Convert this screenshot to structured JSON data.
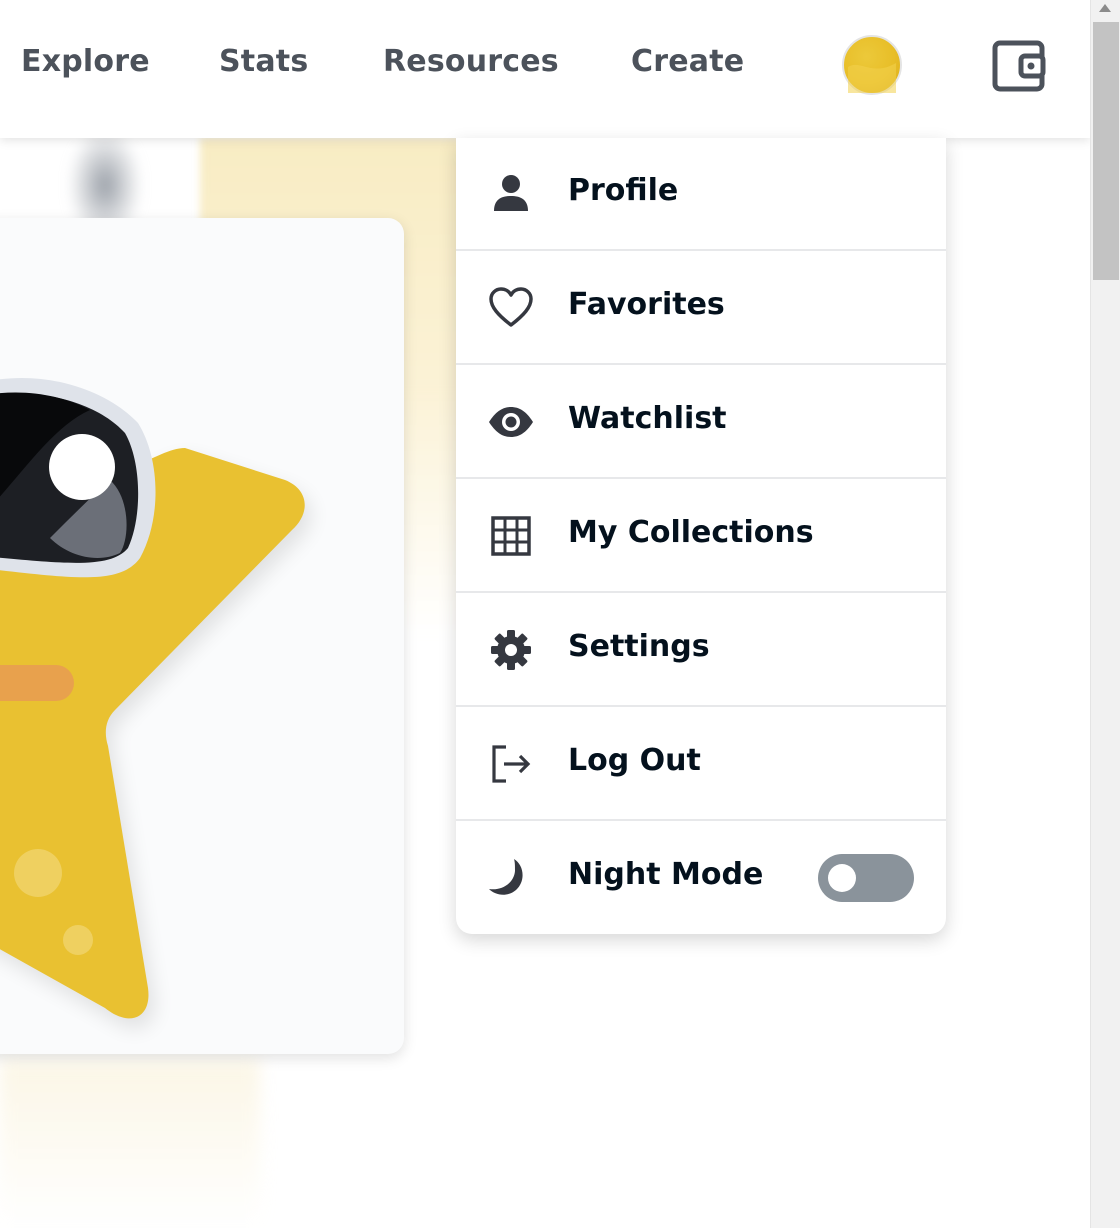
{
  "nav": {
    "explore": "Explore",
    "stats": "Stats",
    "resources": "Resources",
    "create": "Create"
  },
  "icons": {
    "avatar": "profile-avatar",
    "wallet": "wallet-icon"
  },
  "dropdown": {
    "items": [
      {
        "label": "Profile",
        "icon": "person-icon"
      },
      {
        "label": "Favorites",
        "icon": "heart-icon"
      },
      {
        "label": "Watchlist",
        "icon": "eye-icon"
      },
      {
        "label": "My Collections",
        "icon": "grid-icon"
      },
      {
        "label": "Settings",
        "icon": "gear-icon"
      },
      {
        "label": "Log Out",
        "icon": "logout-icon"
      },
      {
        "label": "Night Mode",
        "icon": "moon-icon"
      }
    ],
    "night_mode_on": false
  },
  "colors": {
    "nav_text": "#4c525b",
    "menu_text": "#04111d",
    "icon": "#353840",
    "star_yellow": "#e9c131",
    "toggle_off": "#8a939b"
  }
}
